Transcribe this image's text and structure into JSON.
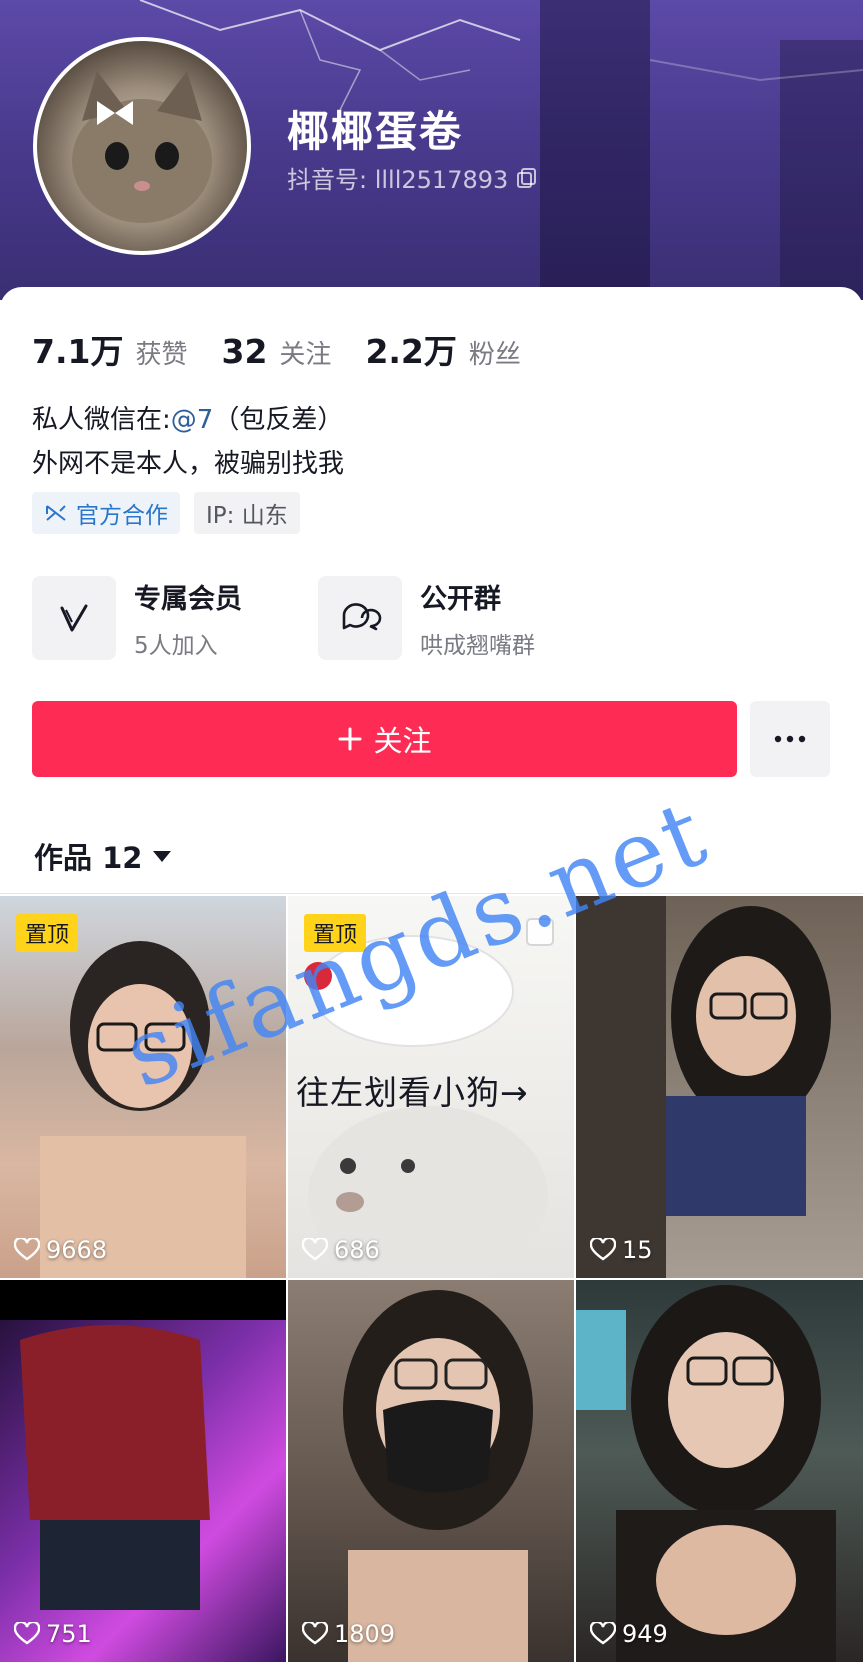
{
  "profile": {
    "nickname": "椰椰蛋卷",
    "douyin_id": "抖音号: llll2517893",
    "stats": [
      {
        "value": "7.1万",
        "label": "获赞"
      },
      {
        "value": "32",
        "label": "关注"
      },
      {
        "value": "2.2万",
        "label": "粉丝"
      }
    ],
    "bio_line1_prefix": "私人微信在:",
    "bio_mention": "@7",
    "bio_line1_suffix": "（包反差）",
    "bio_line2": "外网不是本人，被骗别找我",
    "tags": {
      "coop": "官方合作",
      "ip": "IP: 山东"
    }
  },
  "features": [
    {
      "title": "专属会员",
      "sub": "5人加入",
      "icon": "vip-v-icon"
    },
    {
      "title": "公开群",
      "sub": "哄成翘嘴群",
      "icon": "group-chat-icon"
    }
  ],
  "actions": {
    "follow": "关注",
    "more": "..."
  },
  "works": {
    "tab_label": "作品 12",
    "items": [
      {
        "pinned": "置顶",
        "likes": "9668"
      },
      {
        "pinned": "置顶",
        "likes": "686",
        "caption": "往左划看小狗→"
      },
      {
        "likes": "15"
      },
      {
        "likes": "751"
      },
      {
        "likes": "1809"
      },
      {
        "likes": "949"
      }
    ]
  },
  "watermark": "sifangds.net",
  "colors": {
    "accent": "#fe2c55",
    "pin": "#ffd31a",
    "header": "#4a3b8e",
    "mention": "#2f5f9b"
  }
}
